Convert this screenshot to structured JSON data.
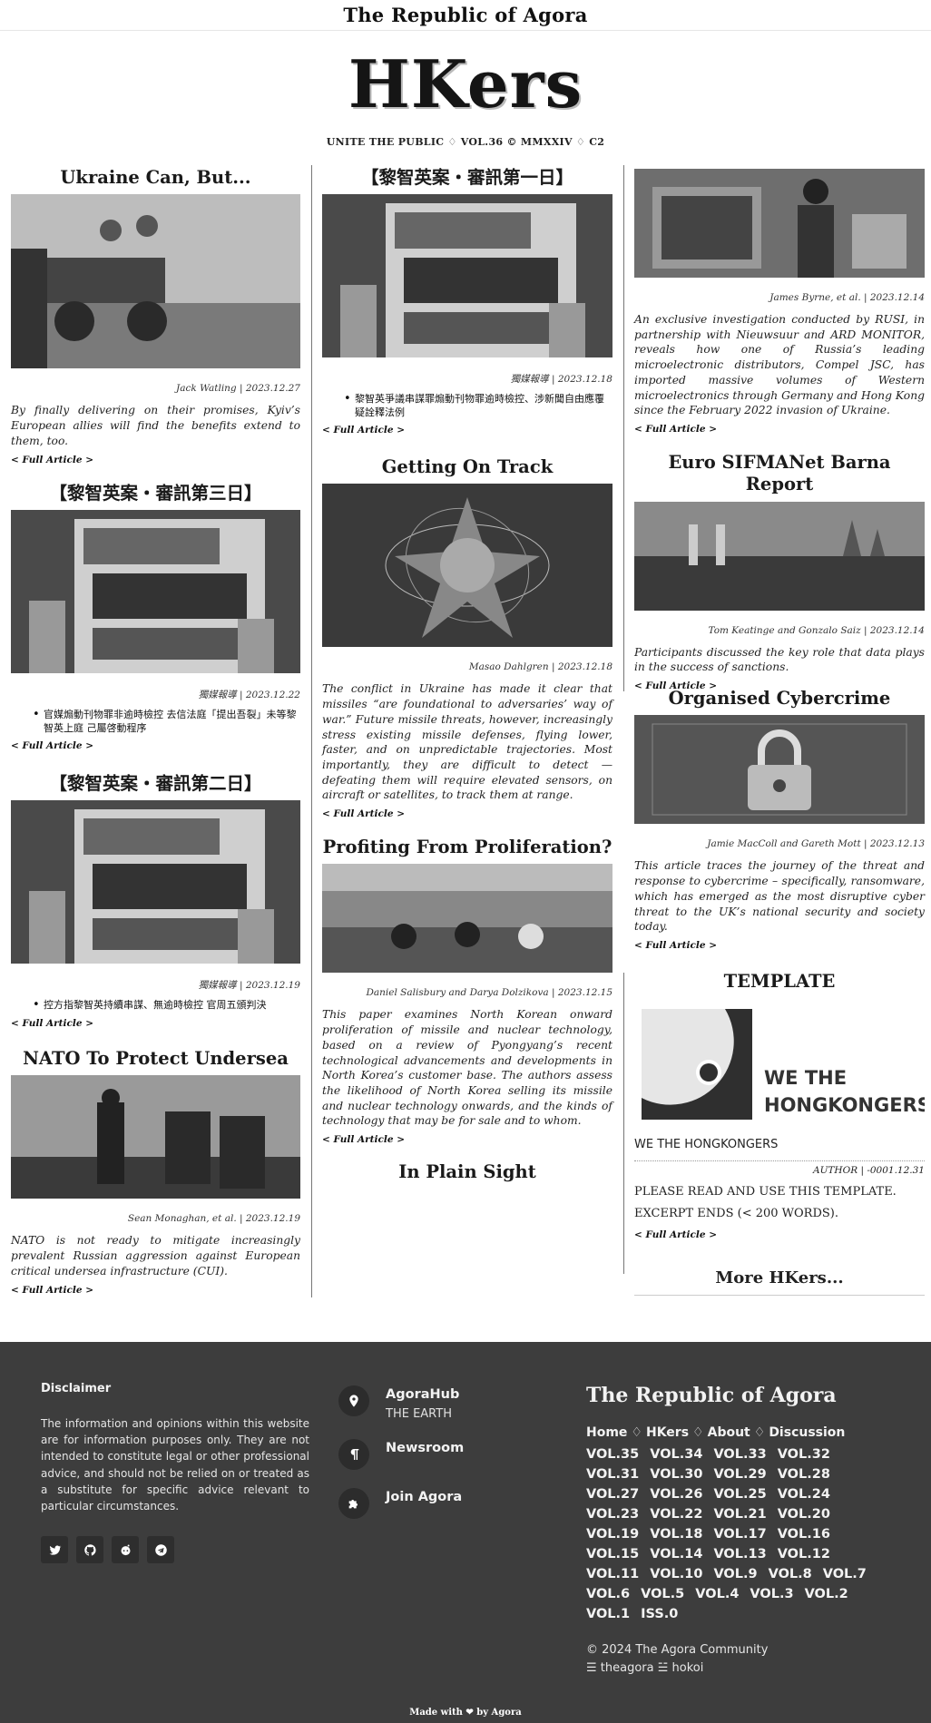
{
  "header": {
    "site_title": "The Republic of Agora"
  },
  "masthead": {
    "logo": "HKers",
    "strap": "UNITE THE PUBLIC ♢ VOL.36 © MMXXIV ♢ C2"
  },
  "full_article_label": "< Full Article >",
  "col1": [
    {
      "title": "Ukraine Can, But...",
      "image": "armored-vehicle-soldiers-photo",
      "byline": "Jack Watling | 2023.12.27",
      "excerpt": "By finally delivering on their promises, Kyiv’s European allies will find the benefits extend to them, too."
    },
    {
      "title": "【黎智英案・審訊第三日】",
      "image": "newspaper-hands-photo",
      "byline": "獨媒報導 | 2023.12.22",
      "bullet": "官媒煽動刊物罪非逾時檢控 去信法庭「提出吾裂」未等黎智英上庭 己屬啓動程序"
    },
    {
      "title": "【黎智英案・審訊第二日】",
      "image": "newspaper-hands-photo",
      "byline": "獨媒報導 | 2023.12.19",
      "bullet": "控方指黎智英持續串謀、無逾時檢控 官周五頒判決"
    },
    {
      "title": "NATO To Protect Undersea",
      "image": "sailor-binoculars-photo",
      "byline": "Sean Monaghan, et al. | 2023.12.19",
      "excerpt": "NATO is not ready to mitigate increasingly prevalent Russian aggression against European critical undersea infrastructure (CUI)."
    }
  ],
  "col2": [
    {
      "title": "【黎智英案・審訊第一日】",
      "image": "newspaper-hands-photo",
      "byline": "獨媒報導 | 2023.12.18",
      "bullet": "黎智英爭議串謀罪煽動刊物罪逾時檢控、涉新聞自由應覆疑詮釋法例"
    },
    {
      "title": "Getting On Track",
      "image": "missile-orbits-star-graphic",
      "byline": "Masao Dahlgren | 2023.12.18",
      "excerpt": "The conflict in Ukraine has made it clear that missiles “are foundational to adversaries’ way of war.” Future missile threats, however, increasingly stress existing missile defenses, flying lower, faster, and on unpredictable trajectories. Most importantly, they are difficult to detect — defeating them will require elevated sensors, on aircraft or satellites, to track them at range."
    },
    {
      "title": "Profiting From Proliferation?",
      "image": "military-parade-photo",
      "byline": "Daniel Salisbury and Darya Dolzikova | 2023.12.15",
      "excerpt": "This paper examines North Korean onward proliferation of missile and nuclear technology, based on a review of Pyongyang’s recent technological advancements and developments in North Korea’s customer base. The authors assess the likelihood of North Korea selling its missile and nuclear technology onwards, and the kinds of technology that may be for sale and to whom."
    },
    {
      "title": "In Plain Sight"
    }
  ],
  "col3": [
    {
      "image": "officer-electronics-illustration",
      "byline": "James Byrne, et al. | 2023.12.14",
      "excerpt": "An exclusive investigation conducted by RUSI, in partnership with Nieuwsuur and ARD MONITOR, reveals how one of Russia’s leading microelectronic distributors, Compel JSC, has imported massive volumes of Western microelectronics through Germany and Hong Kong since the February 2022 invasion of Ukraine."
    },
    {
      "title": "Euro SIFMANet Barna Report",
      "image": "barcelona-skyline-photo",
      "byline": "Tom Keatinge and Gonzalo Saiz | 2023.12.14",
      "excerpt": "Participants discussed the key role that data plays in the success of sanctions."
    },
    {
      "title": "Organised Cybercrime",
      "image": "circuit-padlock-photo",
      "byline": "Jamie MacColl and Gareth Mott | 2023.12.13",
      "excerpt": "This article traces the journey of the threat and response to cybercrime – specifically, ransomware, which has emerged as the most disruptive cyber threat to the UK’s national security and society today."
    },
    {
      "title": "TEMPLATE",
      "logo_text_line1": "WE THE",
      "logo_text_line2": "HONGKONGERS",
      "heading": "WE THE HONGKONGERS",
      "byline": "AUTHOR | -0001.12.31",
      "body_line1": "PLEASE READ AND USE THIS TEMPLATE.",
      "body_line2": "EXCERPT ENDS (< 200 WORDS)."
    }
  ],
  "more_label": "More HKers...",
  "footer": {
    "disclaimer_title": "Disclaimer",
    "disclaimer_text": "The information and opinions within this website are for information purposes only. They are not intended to constitute legal or other professional advice, and should not be relied on or treated as a substitute for specific advice relevant to particular circumstances.",
    "socials": [
      "twitter-icon",
      "github-icon",
      "reddit-icon",
      "telegram-icon"
    ],
    "contacts": [
      {
        "label": "AgoraHub",
        "sub": "THE EARTH",
        "icon": "map-pin-icon"
      },
      {
        "label": "Newsroom",
        "icon": "pilcrow-icon"
      },
      {
        "label": "Join Agora",
        "icon": "puzzle-icon"
      }
    ],
    "brand": "The Republic of Agora",
    "nav": [
      "Home",
      "HKers",
      "About",
      "Discussion"
    ],
    "volumes": [
      "VOL.35",
      "VOL.34",
      "VOL.33",
      "VOL.32",
      "VOL.31",
      "VOL.30",
      "VOL.29",
      "VOL.28",
      "VOL.27",
      "VOL.26",
      "VOL.25",
      "VOL.24",
      "VOL.23",
      "VOL.22",
      "VOL.21",
      "VOL.20",
      "VOL.19",
      "VOL.18",
      "VOL.17",
      "VOL.16",
      "VOL.15",
      "VOL.14",
      "VOL.13",
      "VOL.12",
      "VOL.11",
      "VOL.10",
      "VOL.9",
      "VOL.8",
      "VOL.7",
      "VOL.6",
      "VOL.5",
      "VOL.4",
      "VOL.3",
      "VOL.2",
      "VOL.1",
      "ISS.0"
    ],
    "copyright": "© 2024 The Agora Community",
    "handles": "☰ theagora ☱ hokoi",
    "made_with": "Made with ❤ by Agora"
  },
  "colors": {
    "footer_bg": "#3d3d3d",
    "text": "#222222",
    "rule": "#777777"
  }
}
